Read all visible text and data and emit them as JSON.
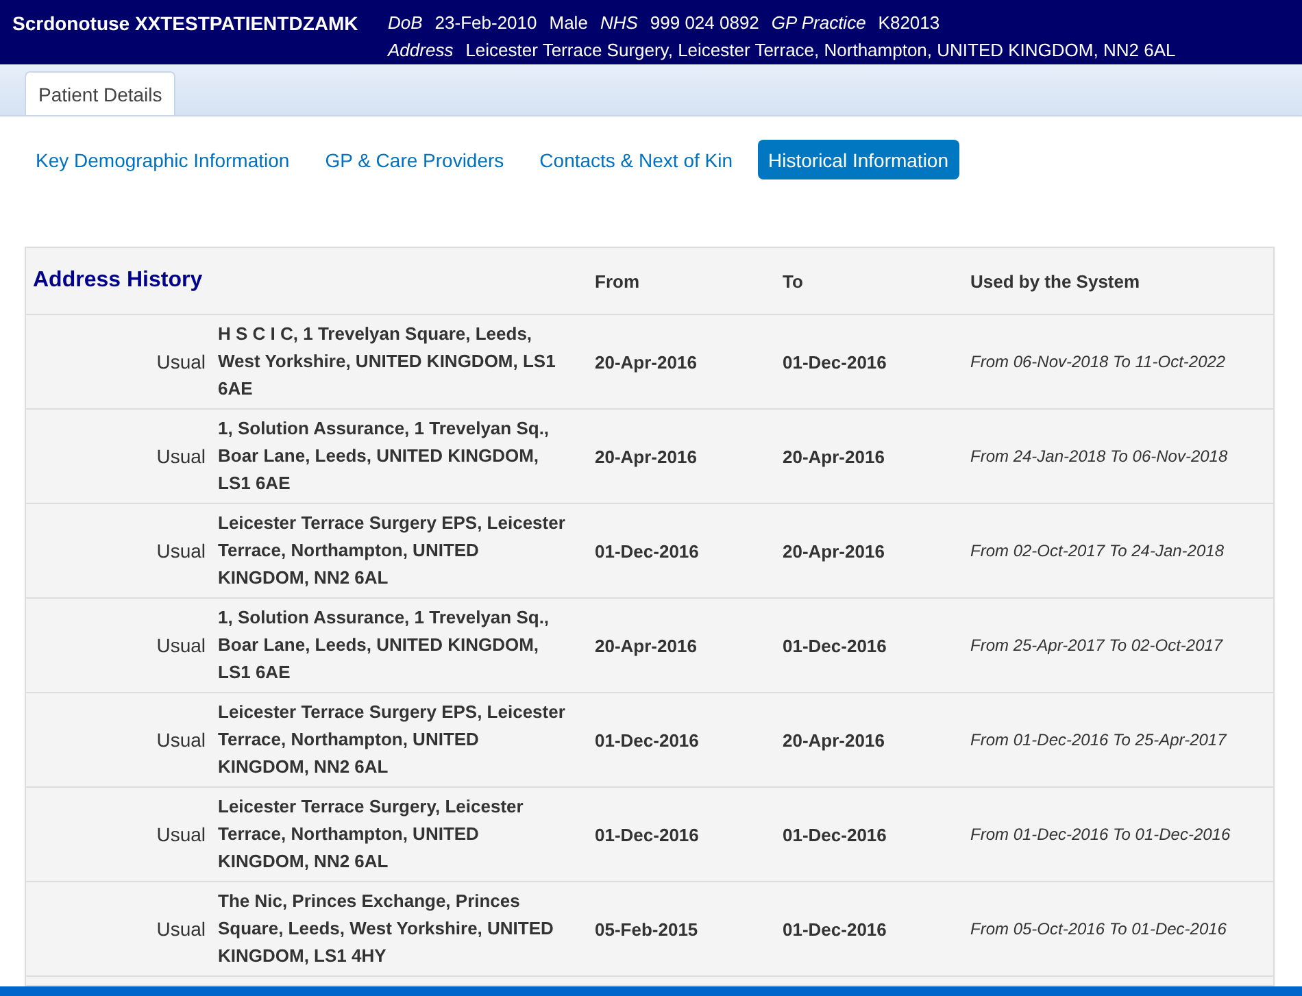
{
  "patient_banner": {
    "name": "Scrdonotuse XXTESTPATIENTDZAMK",
    "fields": [
      {
        "label": "DoB",
        "value": "23-Feb-2010"
      },
      {
        "value": "Male"
      },
      {
        "label": "NHS",
        "value": "999 024 0892"
      },
      {
        "label": "GP Practice",
        "value": "K82013"
      }
    ],
    "address_label": "Address",
    "address": "Leicester Terrace Surgery, Leicester Terrace, Northampton, UNITED KINGDOM, NN2 6AL"
  },
  "tabs": [
    {
      "label": "Patient Details",
      "selected": true
    }
  ],
  "sub_tabs": [
    {
      "label": "Key Demographic Information",
      "selected": false
    },
    {
      "label": "GP & Care Providers",
      "selected": false
    },
    {
      "label": "Contacts & Next of Kin",
      "selected": false
    },
    {
      "label": "Historical Information",
      "selected": true
    }
  ],
  "table": {
    "title": "Address History",
    "columns": [
      "From",
      "To",
      "Used by the System"
    ],
    "rows": [
      {
        "type": "Usual",
        "address": "H S C I C, 1 Trevelyan Square, Leeds, West Yorkshire, UNITED KINGDOM, LS1 6AE",
        "from": "20-Apr-2016",
        "to": "01-Dec-2016",
        "used": "From 06-Nov-2018 To 11-Oct-2022"
      },
      {
        "type": "Usual",
        "address": "1, Solution Assurance, 1 Trevelyan Sq., Boar Lane, Leeds, UNITED KINGDOM, LS1 6AE",
        "from": "20-Apr-2016",
        "to": "20-Apr-2016",
        "used": "From 24-Jan-2018 To 06-Nov-2018"
      },
      {
        "type": "Usual",
        "address": "Leicester Terrace Surgery EPS, Leicester Terrace, Northampton, UNITED KINGDOM, NN2 6AL",
        "from": "01-Dec-2016",
        "to": "20-Apr-2016",
        "used": "From 02-Oct-2017 To 24-Jan-2018"
      },
      {
        "type": "Usual",
        "address": "1, Solution Assurance, 1 Trevelyan Sq., Boar Lane, Leeds, UNITED KINGDOM, LS1 6AE",
        "from": "20-Apr-2016",
        "to": "01-Dec-2016",
        "used": "From 25-Apr-2017 To 02-Oct-2017"
      },
      {
        "type": "Usual",
        "address": "Leicester Terrace Surgery EPS, Leicester Terrace, Northampton, UNITED KINGDOM, NN2 6AL",
        "from": "01-Dec-2016",
        "to": "20-Apr-2016",
        "used": "From 01-Dec-2016 To 25-Apr-2017"
      },
      {
        "type": "Usual",
        "address": "Leicester Terrace Surgery, Leicester Terrace, Northampton, UNITED KINGDOM, NN2 6AL",
        "from": "01-Dec-2016",
        "to": "01-Dec-2016",
        "used": "From 01-Dec-2016 To 01-Dec-2016"
      },
      {
        "type": "Usual",
        "address": "The Nic, Princes Exchange, Princes Square, Leeds, West Yorkshire, UNITED KINGDOM, LS1 4HY",
        "from": "05-Feb-2015",
        "to": "01-Dec-2016",
        "used": "From 05-Oct-2016 To 01-Dec-2016"
      }
    ]
  }
}
